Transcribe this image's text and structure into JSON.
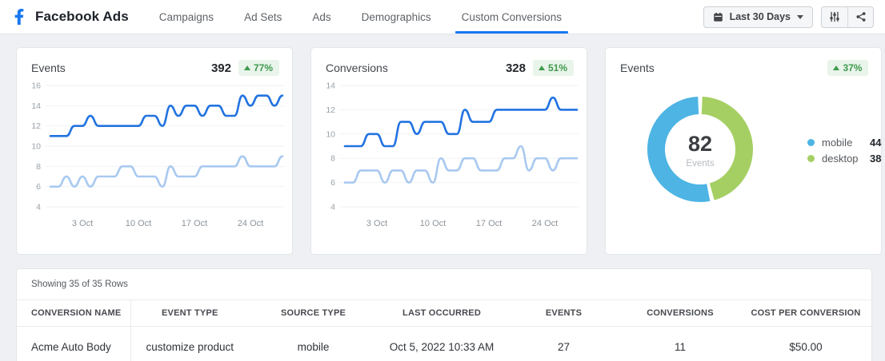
{
  "header": {
    "logo": "facebook-f",
    "app_title": "Facebook Ads",
    "tabs": [
      {
        "label": "Campaigns",
        "active": false
      },
      {
        "label": "Ad Sets",
        "active": false
      },
      {
        "label": "Ads",
        "active": false
      },
      {
        "label": "Demographics",
        "active": false
      },
      {
        "label": "Custom Conversions",
        "active": true
      }
    ],
    "date_range_label": "Last 30 Days",
    "toolbar_icons": [
      "filter-sliders-icon",
      "share-icon"
    ]
  },
  "cards": {
    "events": {
      "title": "Events",
      "value": "392",
      "change": "77%",
      "trend": "up"
    },
    "conversions": {
      "title": "Conversions",
      "value": "328",
      "change": "51%",
      "trend": "up"
    },
    "device_events": {
      "title": "Events",
      "change": "37%",
      "trend": "up"
    }
  },
  "chart_data": [
    {
      "id": "events-trend",
      "type": "line",
      "title": "Events",
      "x_tick_labels": [
        "3 Oct",
        "10 Oct",
        "17 Oct",
        "24 Oct"
      ],
      "x_tick_indices": [
        4,
        11,
        18,
        25
      ],
      "ylim": [
        4,
        16
      ],
      "y_ticks": [
        16,
        14,
        12,
        10,
        8,
        6,
        4
      ],
      "grid": true,
      "series": [
        {
          "name": "events-high",
          "color": "#2273e0",
          "values": [
            11,
            11,
            11,
            12,
            12,
            13,
            12,
            12,
            12,
            12,
            12,
            12,
            13,
            13,
            12,
            14,
            13,
            14,
            14,
            13,
            14,
            14,
            13,
            13,
            15,
            14,
            15,
            15,
            14,
            15
          ]
        },
        {
          "name": "events-low",
          "color": "#a9c9f0",
          "values": [
            6,
            6,
            7,
            6,
            7,
            6,
            7,
            7,
            7,
            8,
            8,
            7,
            7,
            7,
            6,
            8,
            7,
            7,
            7,
            8,
            8,
            8,
            8,
            8,
            9,
            8,
            8,
            8,
            8,
            9
          ]
        }
      ]
    },
    {
      "id": "conversions-trend",
      "type": "line",
      "title": "Conversions",
      "x_tick_labels": [
        "3 Oct",
        "10 Oct",
        "17 Oct",
        "24 Oct"
      ],
      "x_tick_indices": [
        4,
        11,
        18,
        25
      ],
      "ylim": [
        4,
        14
      ],
      "y_ticks": [
        14,
        12,
        10,
        8,
        6,
        4
      ],
      "grid": true,
      "series": [
        {
          "name": "conversions-high",
          "color": "#2273e0",
          "values": [
            9,
            9,
            9,
            10,
            10,
            9,
            9,
            11,
            11,
            10,
            11,
            11,
            11,
            10,
            10,
            12,
            11,
            11,
            11,
            12,
            12,
            12,
            12,
            12,
            12,
            12,
            13,
            12,
            12,
            12
          ]
        },
        {
          "name": "conversions-low",
          "color": "#a9c9f0",
          "values": [
            6,
            6,
            7,
            7,
            7,
            6,
            7,
            7,
            6,
            7,
            7,
            6,
            8,
            7,
            7,
            8,
            8,
            7,
            7,
            7,
            8,
            8,
            9,
            7,
            8,
            8,
            7,
            8,
            8,
            8
          ]
        }
      ]
    },
    {
      "id": "events-by-device",
      "type": "pie",
      "title": "Events",
      "center_value": "82",
      "center_label": "Events",
      "legend_position": "right",
      "slices": [
        {
          "label": "mobile",
          "value": 44,
          "color": "#4db4e4"
        },
        {
          "label": "desktop",
          "value": 38,
          "color": "#a5cf63"
        }
      ]
    }
  ],
  "table": {
    "showing": "Showing 35 of 35 Rows",
    "columns": [
      "CONVERSION NAME",
      "EVENT TYPE",
      "SOURCE TYPE",
      "LAST OCCURRED",
      "EVENTS",
      "CONVERSIONS",
      "COST PER CONVERSION"
    ],
    "rows": [
      [
        "Acme Auto Body",
        "customize product",
        "mobile",
        "Oct 5, 2022 10:33 AM",
        "27",
        "11",
        "$50.00"
      ]
    ]
  },
  "colors": {
    "accent_blue": "#1877f2",
    "line_dark": "#2273e0",
    "line_light": "#a9c9f0",
    "donut_blue": "#4db4e4",
    "donut_green": "#a5cf63",
    "badge_green": "#3e9a4d",
    "badge_bg": "#e9f4ea"
  }
}
